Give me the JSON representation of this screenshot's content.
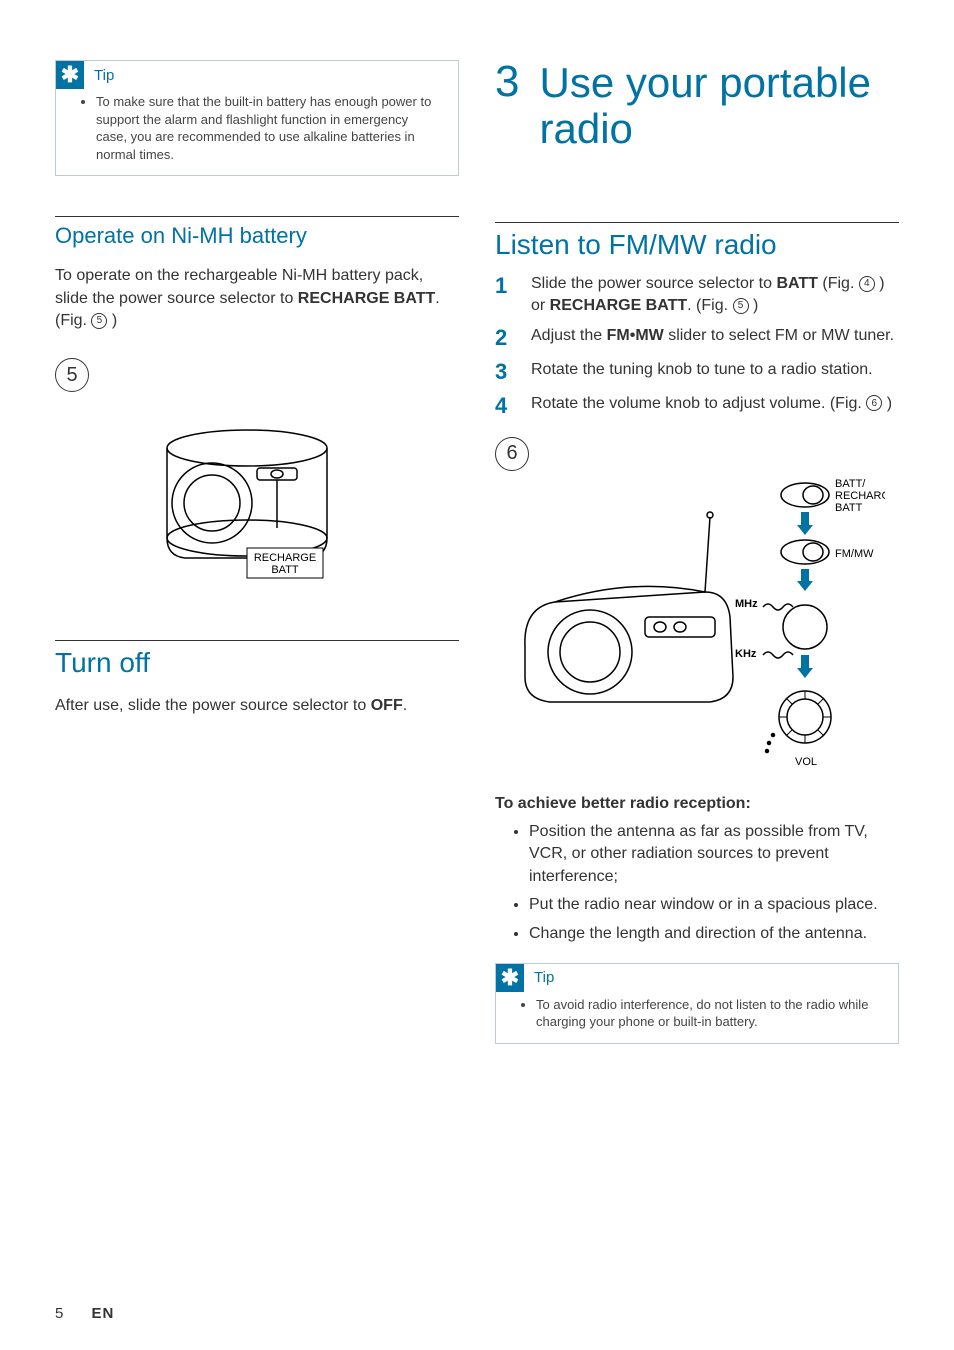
{
  "left": {
    "tip": {
      "label": "Tip",
      "item": "To make sure that the built-in battery has enough power to support the alarm and flashlight function in emergency case, you are recommended to use alkaline batteries in normal times."
    },
    "nimh": {
      "heading": "Operate on Ni-MH battery",
      "para_a": "To operate on the rechargeable Ni-MH battery pack, slide the power source selector to ",
      "para_b": "RECHARGE BATT",
      "para_c": ". (Fig. ",
      "fig": "5",
      "para_d": " )",
      "fig_label_big": "5",
      "callout1": "RECHARGE",
      "callout2": "BATT"
    },
    "turnoff": {
      "heading": "Turn off",
      "para_a": "After use, slide the power source selector to ",
      "para_b": "OFF",
      "para_c": "."
    }
  },
  "right": {
    "chapter_num": "3",
    "chapter_title": "Use your portable radio",
    "listen": {
      "heading": "Listen to FM/MW radio",
      "steps": [
        {
          "n": "1",
          "segs": [
            "Slide the power source selector to ",
            {
              "b": "BATT"
            },
            " (Fig. ",
            {
              "fig": "4"
            },
            " ) or ",
            {
              "b": "RECHARGE BATT"
            },
            ". (Fig. ",
            {
              "fig": "5"
            },
            " )"
          ]
        },
        {
          "n": "2",
          "segs": [
            "Adjust the ",
            {
              "b": "FM•MW"
            },
            " slider to select FM or MW tuner."
          ]
        },
        {
          "n": "3",
          "segs": [
            "Rotate the tuning knob to tune to a radio station."
          ]
        },
        {
          "n": "4",
          "segs": [
            "Rotate the volume knob to adjust volume. (Fig. ",
            {
              "fig": "6"
            },
            " )"
          ]
        }
      ],
      "fig_label_big": "6",
      "ill_labels": {
        "a": "BATT/",
        "b": "RECHARGE",
        "c": "BATT",
        "d": "FM/MW",
        "e": "MHz",
        "f": "KHz",
        "g": "VOL"
      },
      "better_head": "To achieve better radio reception:",
      "bullets": [
        "Position the antenna as far as possible from TV, VCR, or other radiation sources to prevent interference;",
        "Put the radio near window or in a spacious place.",
        "Change the length and direction of the antenna."
      ]
    },
    "tip": {
      "label": "Tip",
      "item": "To avoid radio interference, do not listen to the radio while charging your phone or built-in battery."
    }
  },
  "footer": {
    "page": "5",
    "lang": "EN"
  }
}
